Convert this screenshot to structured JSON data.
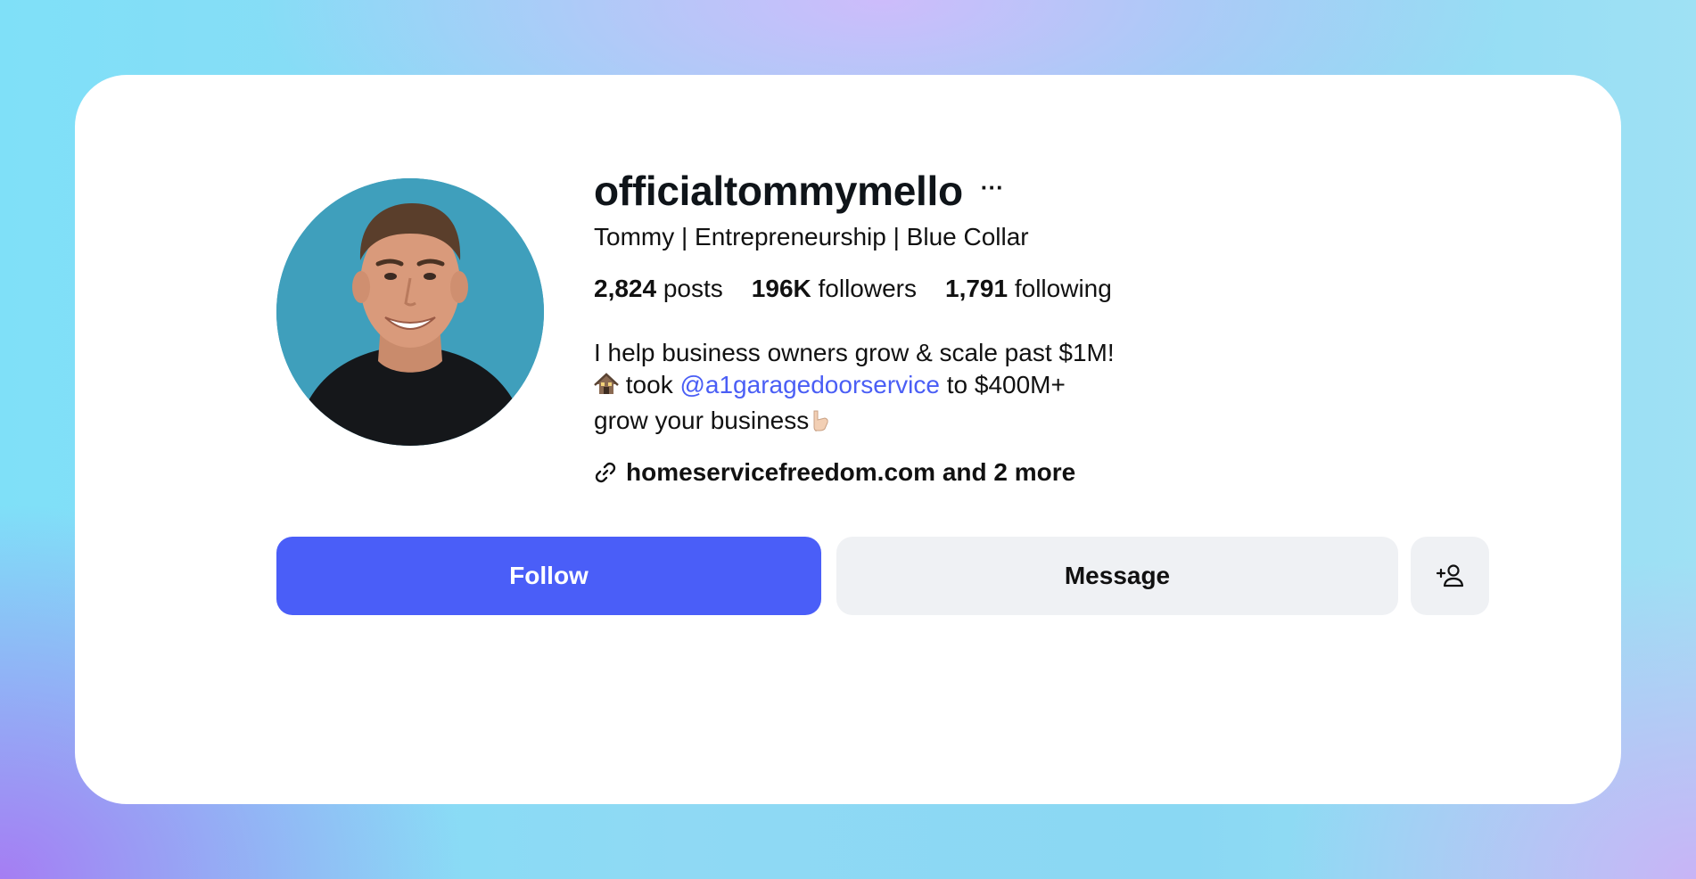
{
  "profile": {
    "username": "officialtommymello",
    "more_label": "···",
    "full_name": "Tommy | Entrepreneurship | Blue Collar",
    "stats": {
      "posts_count": "2,824",
      "posts_label": "posts",
      "followers_count": "196K",
      "followers_label": "followers",
      "following_count": "1,791",
      "following_label": "following"
    },
    "bio": {
      "line1": "I help business owners grow & scale past $1M!",
      "line2_pre": " took ",
      "line2_mention": "@a1garagedoorservice",
      "line2_post": " to $400M+",
      "line3": "grow your business"
    },
    "link_text": "homeservicefreedom.com and 2 more"
  },
  "actions": {
    "follow_label": "Follow",
    "message_label": "Message"
  },
  "icons": {
    "more": "more-options-icon",
    "link": "link-icon",
    "add_user": "add-user-icon",
    "house_emoji": "house-emoji-icon",
    "hand_emoji": "pointing-down-emoji-icon"
  },
  "colors": {
    "accent": "#4a5ef8",
    "mention": "#4a5ef5",
    "secondary_button": "#eff1f4"
  }
}
